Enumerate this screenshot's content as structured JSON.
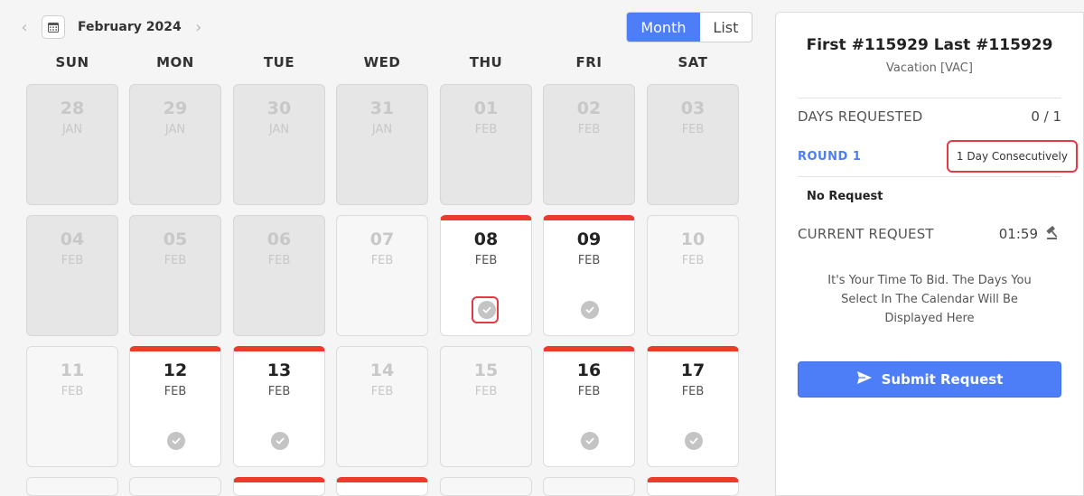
{
  "calendar": {
    "title": "February 2024",
    "view_month": "Month",
    "view_list": "List",
    "weekdays": [
      "SUN",
      "MON",
      "TUE",
      "WED",
      "THU",
      "FRI",
      "SAT"
    ],
    "days": [
      {
        "num": "28",
        "mon": "JAN",
        "state": "past"
      },
      {
        "num": "29",
        "mon": "JAN",
        "state": "past"
      },
      {
        "num": "30",
        "mon": "JAN",
        "state": "past"
      },
      {
        "num": "31",
        "mon": "JAN",
        "state": "past"
      },
      {
        "num": "01",
        "mon": "FEB",
        "state": "past"
      },
      {
        "num": "02",
        "mon": "FEB",
        "state": "past"
      },
      {
        "num": "03",
        "mon": "FEB",
        "state": "past"
      },
      {
        "num": "04",
        "mon": "FEB",
        "state": "past"
      },
      {
        "num": "05",
        "mon": "FEB",
        "state": "past"
      },
      {
        "num": "06",
        "mon": "FEB",
        "state": "past"
      },
      {
        "num": "07",
        "mon": "FEB",
        "state": "blank"
      },
      {
        "num": "08",
        "mon": "FEB",
        "state": "avail",
        "highlight": true
      },
      {
        "num": "09",
        "mon": "FEB",
        "state": "avail"
      },
      {
        "num": "10",
        "mon": "FEB",
        "state": "blank"
      },
      {
        "num": "11",
        "mon": "FEB",
        "state": "blank"
      },
      {
        "num": "12",
        "mon": "FEB",
        "state": "avail"
      },
      {
        "num": "13",
        "mon": "FEB",
        "state": "avail"
      },
      {
        "num": "14",
        "mon": "FEB",
        "state": "blank"
      },
      {
        "num": "15",
        "mon": "FEB",
        "state": "blank"
      },
      {
        "num": "16",
        "mon": "FEB",
        "state": "avail"
      },
      {
        "num": "17",
        "mon": "FEB",
        "state": "avail"
      }
    ],
    "partial_row": [
      "blank",
      "blank",
      "avail",
      "avail",
      "blank",
      "blank",
      "avail"
    ]
  },
  "panel": {
    "name": "First #115929 Last #115929",
    "type": "Vacation [VAC]",
    "days_requested_label": "DAYS REQUESTED",
    "days_requested_value": "0 / 1",
    "round_label": "ROUND 1",
    "consecutive": "1 Day Consecutively",
    "no_request": "No Request",
    "current_request_label": "CURRENT REQUEST",
    "timer": "01:59",
    "help_text": "It's Your Time To Bid. The Days You Select In The Calendar Will Be Displayed Here",
    "submit_label": "Submit Request"
  },
  "colors": {
    "accent": "#4d7ef7",
    "available_bar": "#ec3b2e",
    "highlight": "#e23b47"
  }
}
